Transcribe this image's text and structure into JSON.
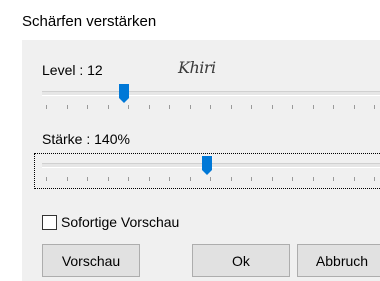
{
  "window": {
    "title": "Schärfen verstärken"
  },
  "level": {
    "label": "Level : 12",
    "value": 12
  },
  "watermark": {
    "text": "Khiri"
  },
  "strength": {
    "label": "Stärke : 140%",
    "value_percent": 140
  },
  "preview": {
    "label": "Sofortige Vorschau",
    "checked": false
  },
  "buttons": {
    "preview_label": "Vorschau",
    "ok_label": "Ok",
    "cancel_label": "Abbruch"
  },
  "colors": {
    "thumb": "#0078d7",
    "dialog_bg": "#f0f0f0",
    "button_bg": "#e1e1e1"
  }
}
